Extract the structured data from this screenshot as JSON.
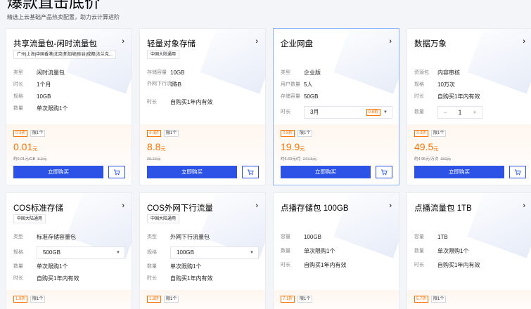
{
  "header": {
    "title": "爆款直击底价",
    "subtitle": "精选上云基础产品热卖配置，助力云计算进阶"
  },
  "colors": {
    "accent": "#2c53e6",
    "price": "#ff7200"
  },
  "cards": [
    {
      "name": "共享流量包-闲时流量包",
      "region": "广州|上海|中国香港|北京|新加坡|硅谷|成都|法兰克...",
      "rows": [
        {
          "k": "类型",
          "v": "闲时流量包"
        },
        {
          "k": "时长",
          "v": "1个月"
        },
        {
          "k": "规格",
          "v": "10GB"
        },
        {
          "k": "数量",
          "v": "单次限购1个"
        }
      ],
      "discount": "0.3折",
      "limit": "限1个",
      "price": "0.01",
      "unit": "元",
      "sub_price": "约0.01元/GB",
      "orig_price": "8.2元",
      "buy": "立即购买"
    },
    {
      "name": "轻量对象存储",
      "region": "中国大陆通用",
      "rows": [
        {
          "k": "存储容量",
          "v": "10GB"
        },
        {
          "k": "外网下行流量",
          "v": "1GB"
        },
        {
          "k": "时长",
          "v": "自购买1年内有效"
        }
      ],
      "discount": "4.4折",
      "limit": "限1个",
      "price": "8.8",
      "unit": "元",
      "sub_price": "",
      "orig_price": "20.16元",
      "buy": "立即购买"
    },
    {
      "name": "企业网盘",
      "region": "",
      "rows": [
        {
          "k": "类型",
          "v": "企业版"
        },
        {
          "k": "用户数量",
          "v": "5人"
        },
        {
          "k": "存储容量",
          "v": "50GB"
        }
      ],
      "select_label": "时长",
      "select_value": "3月",
      "select_discount": "0.8折",
      "discount": "0.8折",
      "limit": "限1个",
      "price": "19.9",
      "unit": "元",
      "sub_price": "约6.63元/月",
      "orig_price": "247.5元",
      "buy": "立即购买"
    },
    {
      "name": "数据万象",
      "region": "",
      "rows": [
        {
          "k": "资源包",
          "v": "内容审核"
        },
        {
          "k": "规格",
          "v": "10万次"
        },
        {
          "k": "时长",
          "v": "自购买1年内有效"
        }
      ],
      "stepper_label": "数量",
      "stepper_minus": "−",
      "stepper_value": "1",
      "stepper_plus": "+",
      "discount": "3.3折",
      "limit": "限1个",
      "price": "49.5",
      "unit": "元",
      "sub_price": "约4.95元/万次",
      "orig_price": "150元",
      "buy": "立即购买"
    },
    {
      "name": "COS标准存储",
      "region": "中国大陆通用",
      "rows": [
        {
          "k": "类型",
          "v": "标准存储容量包"
        }
      ],
      "select_label": "规格",
      "select_value": "500GB",
      "rows2": [
        {
          "k": "数量",
          "v": "单次限购1个"
        },
        {
          "k": "时长",
          "v": "自购买1年内有效"
        }
      ],
      "discount": "1.8折",
      "limit": "限1个"
    },
    {
      "name": "COS外网下行流量",
      "region": "中国大陆通用",
      "rows": [
        {
          "k": "类型",
          "v": "外网下行流量包"
        }
      ],
      "select_label": "规格",
      "select_value": "100GB",
      "rows2": [
        {
          "k": "数量",
          "v": "单次限购1个"
        },
        {
          "k": "时长",
          "v": "自购买1年内有效"
        }
      ],
      "discount": "1.8折",
      "limit": "限1个"
    },
    {
      "name": "点播存储包 100GB",
      "region": "",
      "rows": [
        {
          "k": "容量",
          "v": "100GB"
        },
        {
          "k": "数量",
          "v": "单次限购1个"
        },
        {
          "k": "时长",
          "v": "自购买1年内有效"
        }
      ],
      "discount": "7.1折",
      "limit": "限1个"
    },
    {
      "name": "点播流量包 1TB",
      "region": "",
      "rows": [
        {
          "k": "容量",
          "v": "1TB"
        },
        {
          "k": "数量",
          "v": "单次限购1个"
        },
        {
          "k": "时长",
          "v": "自购买1年内有效"
        }
      ],
      "discount": "5.7折",
      "limit": "限1个"
    }
  ]
}
